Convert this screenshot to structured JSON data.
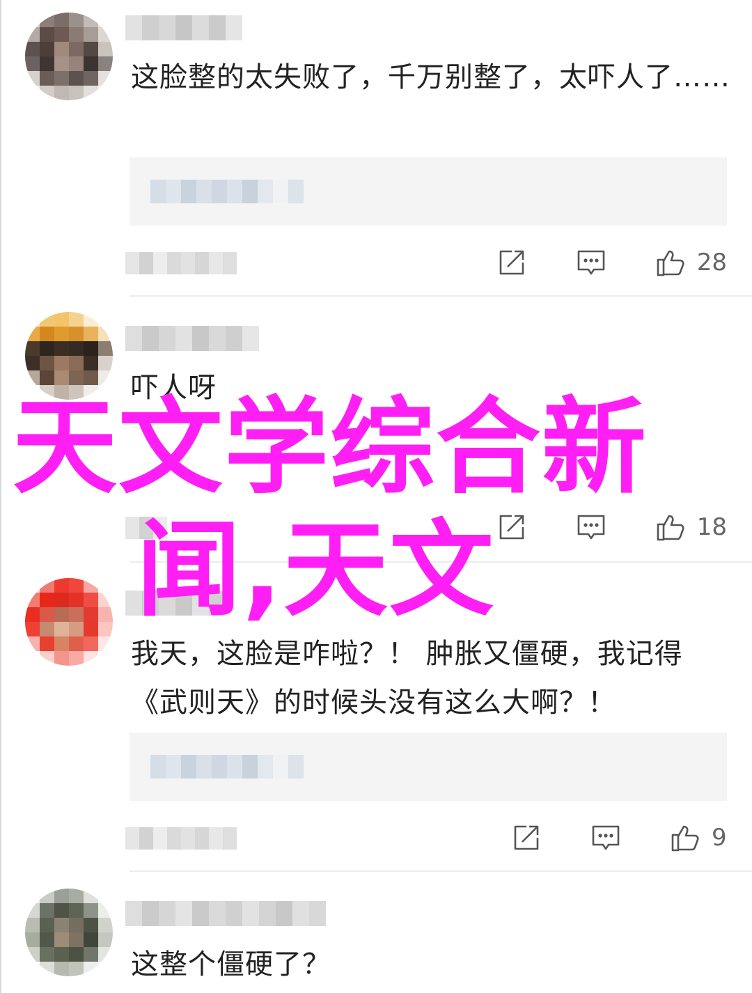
{
  "comments": [
    {
      "text": "这脸整的太失败了，千万别整了，太吓人了……",
      "likes": "28",
      "has_quote": true
    },
    {
      "text": "吓人呀",
      "likes": "18",
      "has_quote": false
    },
    {
      "text": "我天，这脸是咋啦？！ 肿胀又僵硬，我记得《武则天》的时候头没有这么大啊？！",
      "likes": "9",
      "has_quote": true
    },
    {
      "text": "这整个僵硬了？",
      "likes": "",
      "has_quote": false
    }
  ],
  "overlay": {
    "line1": "天文学综合新",
    "line2": "闻,天文",
    "color": "#ff1ff5"
  },
  "icons": {
    "share": "share-icon",
    "reply": "reply-icon",
    "like": "thumbs-up-icon"
  },
  "colors": {
    "text": "#222222",
    "meta": "#666666",
    "quote_bg": "#f4f4f4",
    "divider": "#ececec"
  }
}
